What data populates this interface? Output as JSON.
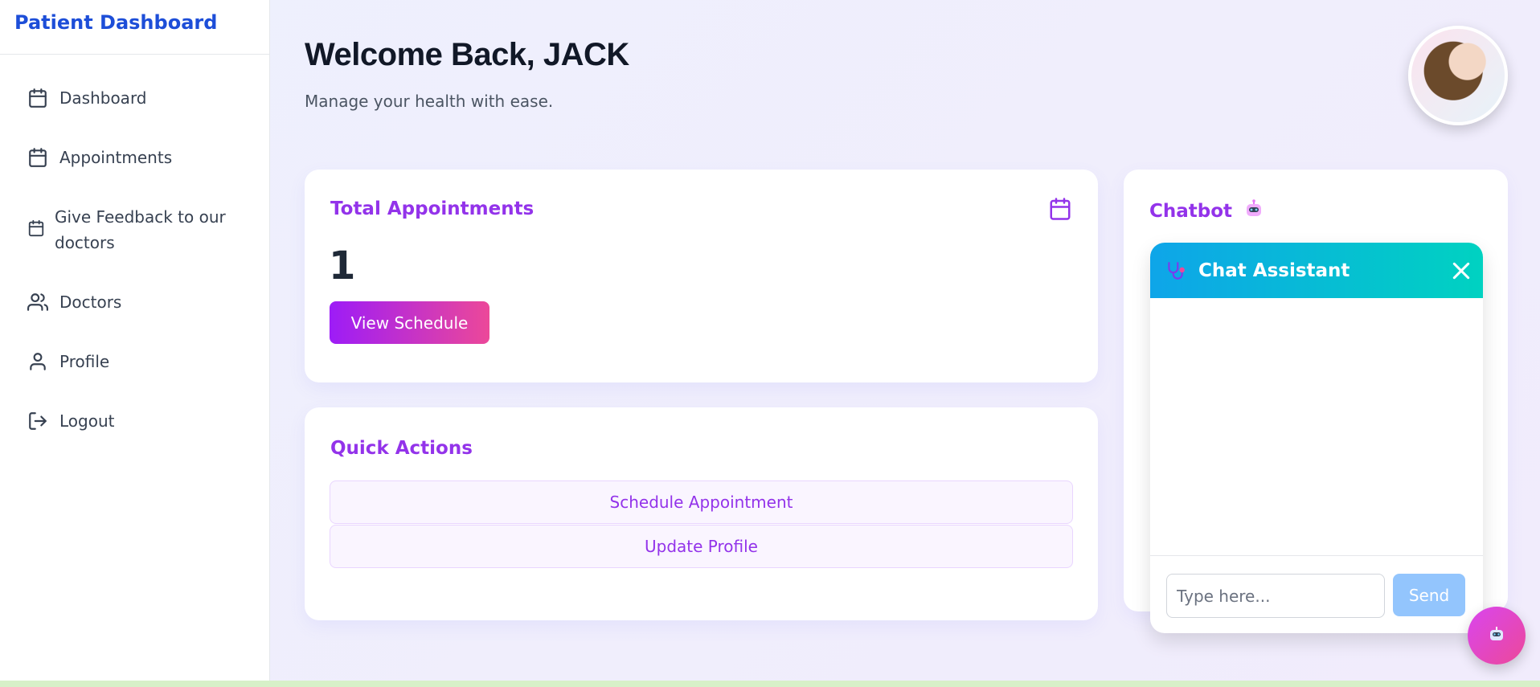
{
  "sidebar": {
    "title": "Patient Dashboard",
    "items": [
      {
        "label": "Dashboard",
        "icon": "calendar-icon"
      },
      {
        "label": "Appointments",
        "icon": "calendar-icon"
      },
      {
        "label": "Give Feedback to our doctors",
        "icon": "calendar-icon"
      },
      {
        "label": "Doctors",
        "icon": "users-icon"
      },
      {
        "label": "Profile",
        "icon": "user-icon"
      },
      {
        "label": "Logout",
        "icon": "logout-icon"
      }
    ]
  },
  "header": {
    "title": "Welcome Back, JACK",
    "subtitle": "Manage your health with ease."
  },
  "appointments_card": {
    "title": "Total Appointments",
    "count": "1",
    "button_label": "View Schedule"
  },
  "quick_actions": {
    "title": "Quick Actions",
    "actions": [
      "Schedule Appointment",
      "Update Profile"
    ]
  },
  "chatbot_card": {
    "title": "Chatbot"
  },
  "chat_widget": {
    "title": "Chat Assistant",
    "input_placeholder": "Type here...",
    "send_label": "Send"
  },
  "colors": {
    "brand_blue": "#1d4ed8",
    "accent_purple": "#9333ea",
    "chat_gradient_start": "#0ea5e9",
    "chat_gradient_end": "#00d2c1"
  }
}
